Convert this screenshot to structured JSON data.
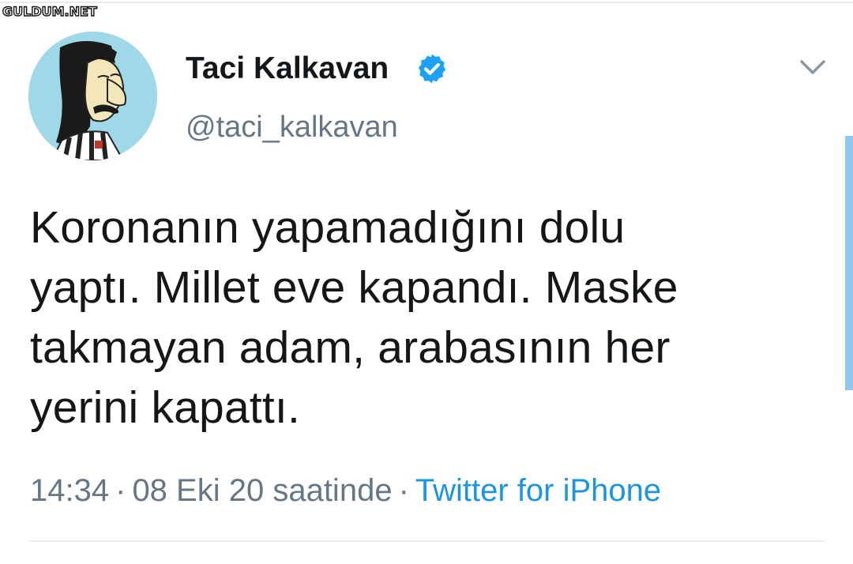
{
  "watermark": "GULDUM.NET",
  "tweet": {
    "display_name": "Taci Kalkavan",
    "handle": "@taci_kalkavan",
    "text": "Koronanın yapamadığını dolu\nyaptı. Millet eve kapandı. Maske\ntakmayan adam, arabasının her\nyerini kapattı.",
    "time": "14:34",
    "date": "08 Eki 20 saatinde",
    "separator": "·",
    "source": "Twitter for iPhone"
  },
  "icons": {
    "verified": "verified-badge-icon",
    "menu": "chevron-down-icon",
    "avatar": "cartoon-avatar"
  },
  "colors": {
    "text": "#14171a",
    "secondary": "#657786",
    "link": "#1b95e0",
    "verified": "#1da1f2",
    "avatar_bg": "#9fd8e8",
    "divider": "#e6ecf0"
  }
}
